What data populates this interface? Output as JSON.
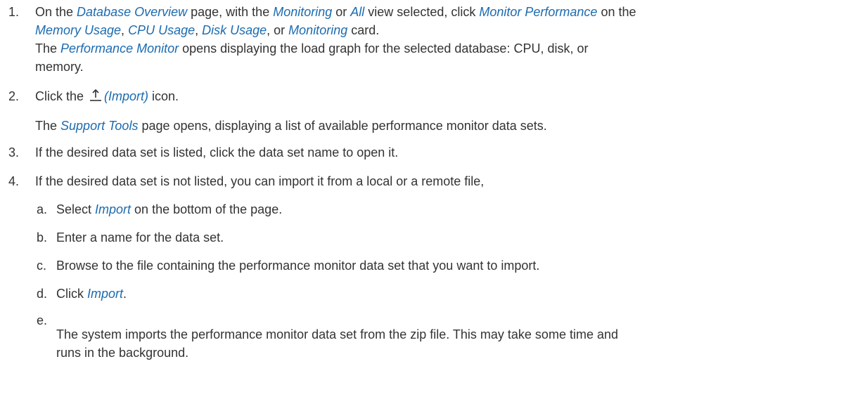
{
  "steps": [
    {
      "num": "1.",
      "l1": {
        "a": "On the ",
        "b": "Database Overview",
        "c": " page, with the ",
        "d": "Monitoring",
        "e": " or ",
        "f": "All",
        "g": " view selected, click ",
        "h": "Monitor Performance",
        "i": " on the"
      },
      "l2": {
        "a": "Memory Usage",
        "b": ", ",
        "c": "CPU Usage",
        "d": ", ",
        "e": "Disk Usage",
        "f": ", or ",
        "g": "Monitoring",
        "h": " card."
      },
      "l3": {
        "a": "The ",
        "b": "Performance Monitor",
        "c": " opens displaying the load graph for the selected database: CPU, disk, or"
      },
      "l4": "memory."
    },
    {
      "num": "2.",
      "l1": {
        "a": "Click the ",
        "icon": "import-icon",
        "b": "(Import)",
        "c": " icon."
      },
      "l2": {
        "a": "The ",
        "b": "Support Tools",
        "c": " page opens, displaying a list of available performance monitor data sets."
      }
    },
    {
      "num": "3.",
      "text": "If the desired data set is listed, click the data set name to open it."
    },
    {
      "num": "4.",
      "text": "If the desired data set is not listed, you can import it from a local or a remote file,"
    }
  ],
  "substeps": [
    {
      "num": "a.",
      "a": "Select ",
      "b": "Import",
      "c": " on the bottom of the page."
    },
    {
      "num": "b.",
      "text": "Enter a name for the data set."
    },
    {
      "num": "c.",
      "text": "Browse to the file containing the performance monitor data set that you want to import."
    },
    {
      "num": "d.",
      "a": "Click ",
      "b": "Import",
      "c": "."
    },
    {
      "num": "e.",
      "l1": "The system imports the performance monitor data set from the zip file. This may take some time and",
      "l2": "runs in the background."
    }
  ],
  "colors": {
    "link": "#1c6bb0",
    "text": "#333333"
  }
}
